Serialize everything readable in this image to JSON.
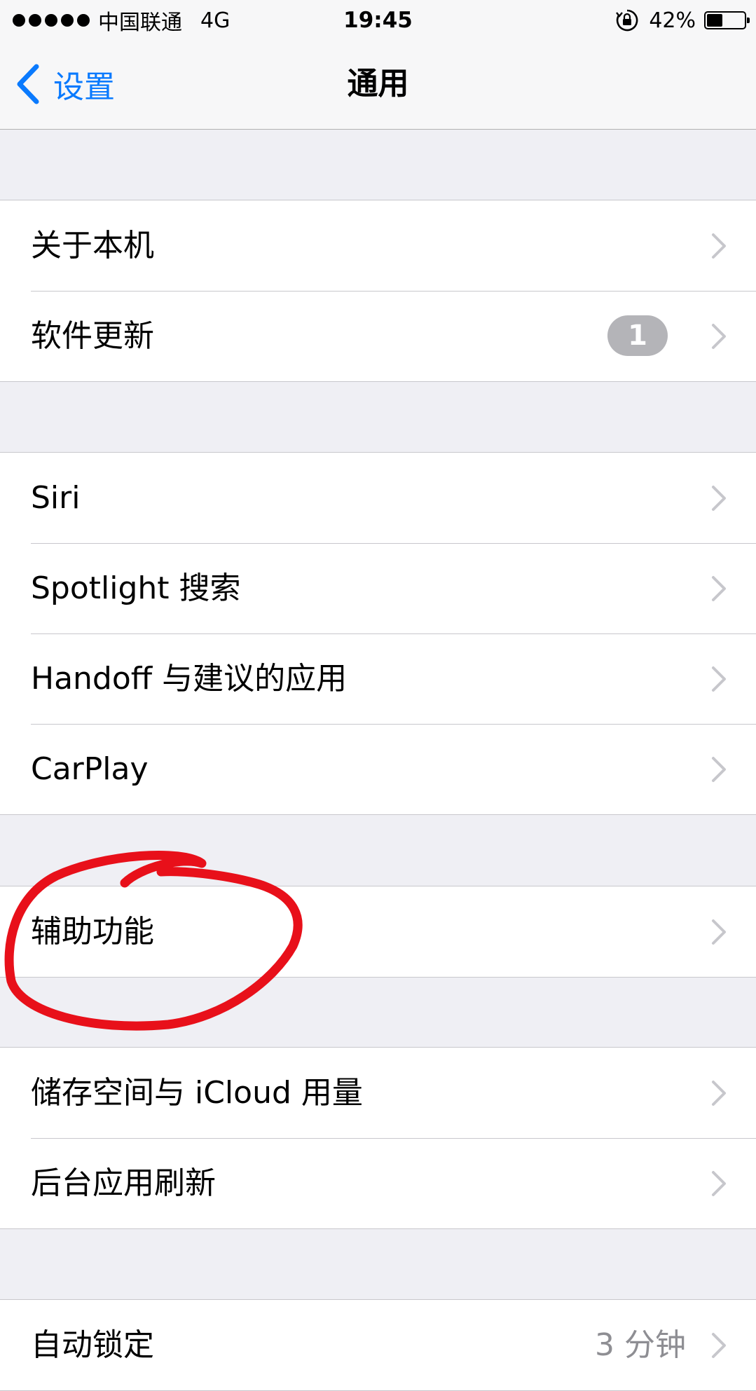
{
  "status_bar": {
    "carrier": "中国联通",
    "network": "4G",
    "time": "19:45",
    "battery_percent": "42%",
    "battery_level": 0.42,
    "icons": [
      "signal-dots-icon",
      "rotation-lock-icon",
      "battery-icon"
    ]
  },
  "nav": {
    "back_label": "设置",
    "title": "通用"
  },
  "groups": [
    {
      "rows": [
        {
          "label": "关于本机"
        },
        {
          "label": "软件更新",
          "badge": "1"
        }
      ]
    },
    {
      "rows": [
        {
          "label": "Siri"
        },
        {
          "label": "Spotlight 搜索"
        },
        {
          "label": "Handoff 与建议的应用"
        },
        {
          "label": "CarPlay"
        }
      ]
    },
    {
      "rows": [
        {
          "label": "辅助功能"
        }
      ]
    },
    {
      "rows": [
        {
          "label": "储存空间与 iCloud 用量"
        },
        {
          "label": "后台应用刷新"
        }
      ]
    },
    {
      "rows": [
        {
          "label": "自动锁定",
          "value": "3 分钟"
        }
      ]
    }
  ],
  "colors": {
    "accent": "#0a7afe",
    "annotation": "#e8101a",
    "background": "#efeff4",
    "badge": "#b4b4b8"
  }
}
